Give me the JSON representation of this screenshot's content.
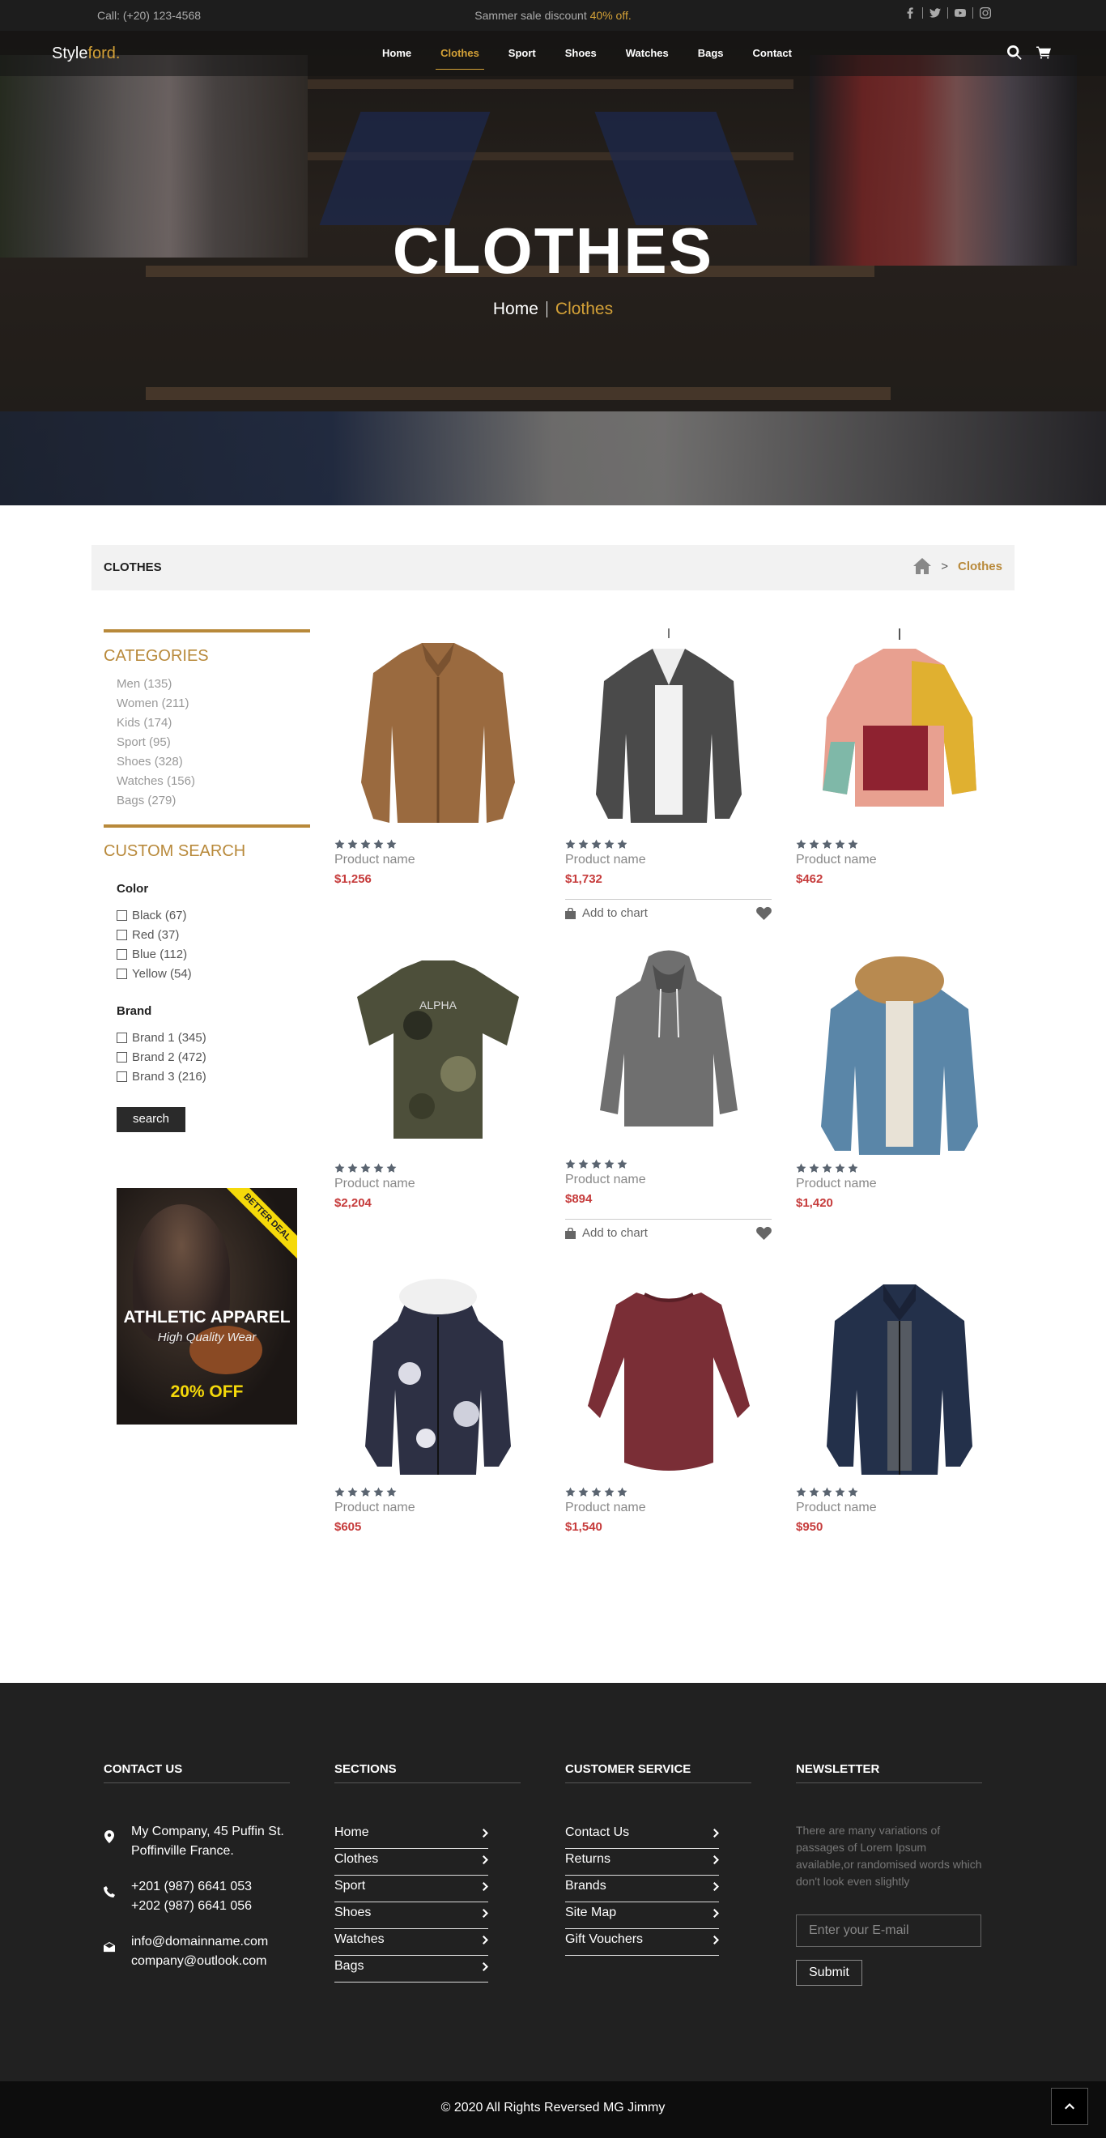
{
  "topbar": {
    "phone": "Call: (+20) 123-4568",
    "promo_text": "Sammer sale discount",
    "promo_highlight": "40% off."
  },
  "brand": {
    "logo_main": "Style",
    "logo_accent": "ford."
  },
  "nav": {
    "items": [
      {
        "label": "Home"
      },
      {
        "label": "Clothes",
        "active": true
      },
      {
        "label": "Sport"
      },
      {
        "label": "Shoes"
      },
      {
        "label": "Watches"
      },
      {
        "label": "Bags"
      },
      {
        "label": "Contact"
      }
    ]
  },
  "hero": {
    "title": "CLOTHES",
    "crumb_home": "Home",
    "crumb_current": "Clothes"
  },
  "page_header": {
    "title": "CLOTHES",
    "crumb_sep": ">",
    "crumb_current": "Clothes"
  },
  "sidebar": {
    "categories_title": "CATEGORIES",
    "categories": [
      "Men (135)",
      "Women (211)",
      "Kids (174)",
      "Sport (95)",
      "Shoes (328)",
      "Watches (156)",
      "Bags (279)"
    ],
    "custom_search_title": "CUSTOM SEARCH",
    "color_title": "Color",
    "colors": [
      "Black (67)",
      "Red (37)",
      "Blue (112)",
      "Yellow (54)"
    ],
    "brand_title": "Brand",
    "brands": [
      "Brand 1 (345)",
      "Brand 2 (472)",
      "Brand 3 (216)"
    ],
    "search_button": "search",
    "ad": {
      "ribbon": "BETTER DEAL",
      "headline": "ATHLETIC APPAREL",
      "sub": "High Quality Wear",
      "offer": "20% OFF"
    }
  },
  "products": [
    {
      "name": "Product name",
      "price": "$1,256",
      "image": "brown-jacket",
      "color": "#9a6a3f",
      "rating": 5
    },
    {
      "name": "Product name",
      "price": "$1,732",
      "image": "denim-jacket",
      "color": "#4a4a4a",
      "rating": 5,
      "add_label": "Add to chart"
    },
    {
      "name": "Product name",
      "price": "$462",
      "image": "hoodie-colorblock",
      "color": "#e8a090",
      "rating": 5
    },
    {
      "name": "Product name",
      "price": "$2,204",
      "image": "camo-tshirt",
      "color": "#4d4f3a",
      "rating": 5
    },
    {
      "name": "Product name",
      "price": "$894",
      "image": "grey-hoodie",
      "color": "#6f6f6f",
      "rating": 5,
      "add_label": "Add to chart"
    },
    {
      "name": "Product name",
      "price": "$1,420",
      "image": "fur-denim-jacket",
      "color": "#5a86a8",
      "rating": 5
    },
    {
      "name": "Product name",
      "price": "$605",
      "image": "camo-parka",
      "color": "#2d3044",
      "rating": 5
    },
    {
      "name": "Product name",
      "price": "$1,540",
      "image": "maroon-longsleeve",
      "color": "#7a2e36",
      "rating": 5
    },
    {
      "name": "Product name",
      "price": "$950",
      "image": "navy-puffer",
      "color": "#23304a",
      "rating": 5
    }
  ],
  "footer": {
    "contact_title": "CONTACT US",
    "address": [
      "My Company, 45 Puffin St.",
      "Poffinville France."
    ],
    "phones": [
      "+201 (987) 6641 053",
      "+202 (987) 6641 056"
    ],
    "emails": [
      "info@domainname.com",
      "company@outlook.com"
    ],
    "sections_title": "SECTIONS",
    "sections": [
      "Home",
      "Clothes",
      "Sport",
      "Shoes",
      "Watches",
      "Bags"
    ],
    "service_title": "CUSTOMER SERVICE",
    "service": [
      "Contact Us",
      "Returns",
      "Brands",
      "Site Map",
      "Gift Vouchers"
    ],
    "newsletter_title": "NEWSLETTER",
    "newsletter_text": "There are many variations of passages of Lorem Ipsum available,or randomised words which don't look even slightly",
    "email_placeholder": "Enter your E-mail",
    "submit_label": "Submit",
    "copyright": "© 2020 All Rights Reversed MG Jimmy"
  }
}
